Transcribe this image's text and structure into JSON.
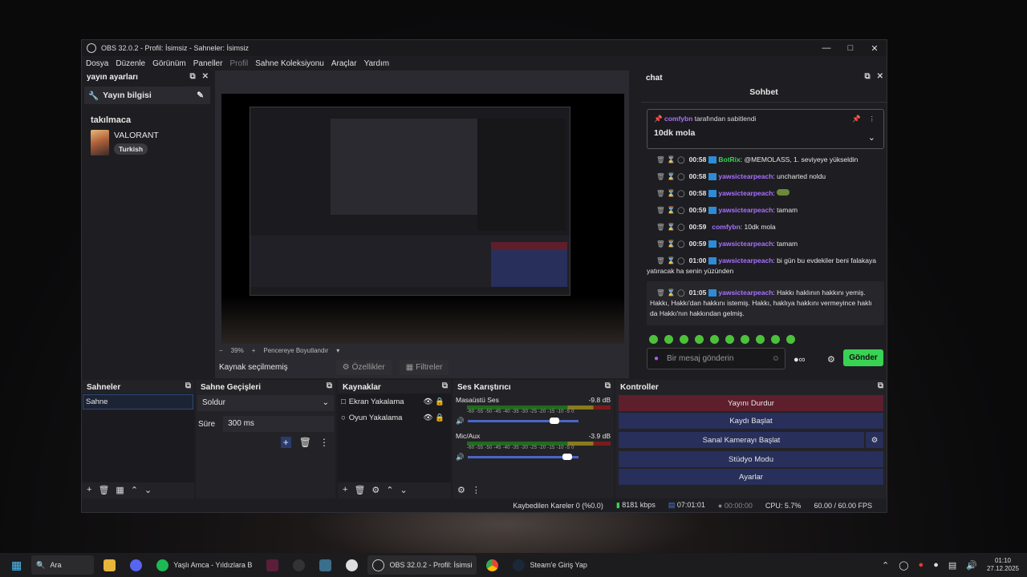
{
  "window": {
    "title": "OBS 32.0.2 - Profil: İsimsiz - Sahneler: İsimsiz"
  },
  "menu": [
    "Dosya",
    "Düzenle",
    "Görünüm",
    "Paneller",
    "Profil",
    "Sahne Koleksiyonu",
    "Araçlar",
    "Yardım"
  ],
  "left_dock": {
    "title": "yayın ayarları",
    "info_label": "Yayın bilgisi",
    "stream_title": "takılmaca",
    "game": "VALORANT",
    "tag": "Turkish"
  },
  "preview": {
    "zoom": "39%",
    "fit_label": "Pencereye Boyutlandır",
    "no_source": "Kaynak seçilmemiş",
    "props_btn": "Özellikler",
    "filters_btn": "Filtreler"
  },
  "chat": {
    "dock_title": "chat",
    "header": "Sohbet",
    "pinned_by": "comfybn",
    "pinned_suffix": "tarafından sabitlendi",
    "pinned_msg": "10dk mola",
    "messages": [
      {
        "t": "00:58",
        "u": "BotRix",
        "m": ": @MEMOLASS, 1. seviyeye yükseldin"
      },
      {
        "t": "00:58",
        "u": "yawsictearpeach",
        "m": ": uncharted noldu"
      },
      {
        "t": "00:58",
        "u": "yawsictearpeach",
        "m": ":"
      },
      {
        "t": "00:59",
        "u": "yawsictearpeach",
        "m": ": tamam"
      },
      {
        "t": "00:59",
        "u": "comfybn",
        "m": ": 10dk mola"
      },
      {
        "t": "00:59",
        "u": "yawsictearpeach",
        "m": ": tamam"
      },
      {
        "t": "01:00",
        "u": "yawsictearpeach",
        "m": ": bi gün bu evdekiler beni falakaya yatıracak ha senin yüzünden"
      },
      {
        "t": "01:05",
        "u": "yawsictearpeach",
        "m": ": Hakkı haklının hakkını yemiş. Hakkı, Hakkı'dan hakkını istemiş. Hakkı, haklıya hakkını vermeyince haklı da Hakkı'nın hakkından gelmiş."
      }
    ],
    "input_placeholder": "Bir mesaj gönderin",
    "send": "Gönder"
  },
  "scenes": {
    "title": "Sahneler",
    "items": [
      "Sahne"
    ]
  },
  "transitions": {
    "title": "Sahne Geçişleri",
    "type": "Soldur",
    "duration_label": "Süre",
    "duration": "300 ms"
  },
  "sources": {
    "title": "Kaynaklar",
    "items": [
      "Ekran Yakalama",
      "Oyun Yakalama"
    ]
  },
  "mixer": {
    "title": "Ses Karıştırıcı",
    "channels": [
      {
        "name": "Masaüstü Ses",
        "db": "-9.8 dB",
        "level": 0.78
      },
      {
        "name": "Mic/Aux",
        "db": "-3.9 dB",
        "level": 0.9
      }
    ],
    "ticks": "-60 -55 -50 -45 -40 -35 -30 -25 -20 -15 -10 -5 0"
  },
  "controls": {
    "title": "Kontroller",
    "buttons": [
      "Yayını Durdur",
      "Kaydı Başlat",
      "Sanal Kamerayı Başlat",
      "Stüdyo Modu",
      "Ayarlar"
    ]
  },
  "status": {
    "dropped": "Kaybedilen Kareler 0 (%0.0)",
    "bitrate": "8181 kbps",
    "stream_time": "07:01:01",
    "rec_time": "00:00:00",
    "cpu": "CPU: 5.7%",
    "fps": "60.00 / 60.00 FPS"
  },
  "taskbar": {
    "search": "Ara",
    "spotify": "Yaşlı Amca - Yıldızlara B",
    "obs": "OBS 32.0.2 - Profil: İsimsi",
    "steam": "Steam'e Giriş Yap",
    "time": "01:10",
    "date": "27.12.2025"
  }
}
